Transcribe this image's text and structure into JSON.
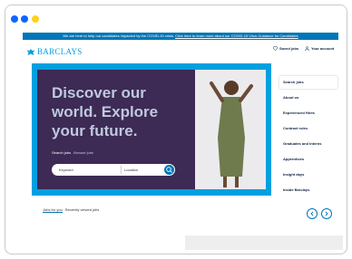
{
  "colors": {
    "mac_close": "#0a67ff",
    "mac_min": "#0a67ff",
    "mac_max": "#ffd21a",
    "banner_bg": "#0076b6",
    "hero_frame": "#00a0e0",
    "hero_bg": "#3d2a55",
    "brand": "#00a0e0",
    "navy": "#0a2240"
  },
  "banner": {
    "text": "We are here to help our candidates impacted by the COVID-19 crisis.",
    "link": "Click here to learn more about our COVID-19 Virus Guidance for Candidates"
  },
  "header": {
    "logo_text": "BARCLAYS",
    "logo_icon": "eagle-icon",
    "saved_jobs": "Saved jobs",
    "saved_icon": "heart-icon",
    "your_account": "Your account",
    "account_icon": "user-icon"
  },
  "hero": {
    "headline": "Discover our world. Explore your future.",
    "tabs": [
      "Search jobs",
      "Browse jobs"
    ],
    "keyword_placeholder": "Keyword",
    "location_placeholder": "Location",
    "search_icon": "search-icon"
  },
  "sidenav": {
    "items": [
      {
        "label": "Search jobs",
        "active": true
      },
      {
        "label": "About us"
      },
      {
        "label": "Experienced Hires"
      },
      {
        "label": "Contract roles"
      },
      {
        "label": "Graduates and Interns"
      },
      {
        "label": "Apprentices"
      },
      {
        "label": "Insight days"
      },
      {
        "label": "Inside Barclays"
      }
    ]
  },
  "jobs": {
    "tabs": [
      "Jobs for you",
      "Recently viewed jobs"
    ]
  }
}
